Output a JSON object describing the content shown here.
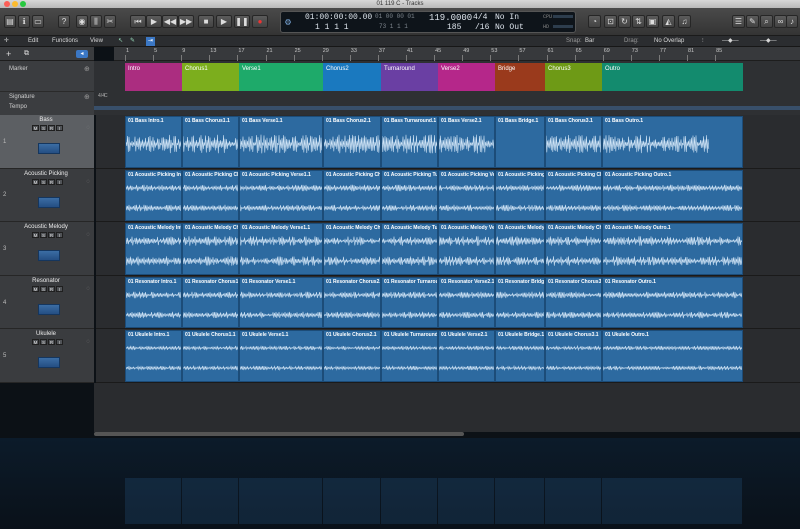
{
  "window": {
    "title": "01 119 C - Tracks"
  },
  "lcd": {
    "position_time": "01:00:00:00.00",
    "position_bars": "1 1 1 1",
    "right_time": "01 00 00 01",
    "right_bars": "73 1 1 1",
    "tempo": "119.0000",
    "tempo_sub": "185",
    "signature": "4/4",
    "division": "/16",
    "in": "No In",
    "out": "No Out",
    "cpu": "CPU",
    "hd": "HD"
  },
  "menu": {
    "edit": "Edit",
    "functions": "Functions",
    "view": "View",
    "snap_label": "Snap:",
    "snap_value": "Bar",
    "drag_label": "Drag:",
    "drag_value": "No Overlap"
  },
  "ruler": {
    "ticks": [
      "1",
      "5",
      "9",
      "13",
      "17",
      "21",
      "25",
      "29",
      "33",
      "37",
      "41",
      "45",
      "49",
      "53",
      "57",
      "61",
      "65",
      "69",
      "73",
      "77",
      "81",
      "85"
    ]
  },
  "global_tracks": {
    "marker": "Marker",
    "signature": "Signature",
    "tempo": "Tempo",
    "sig_value": "4/4",
    "key": "C"
  },
  "markers": [
    {
      "label": "Intro",
      "color": "#ab2d80"
    },
    {
      "label": "Chorus1",
      "color": "#7cae1d"
    },
    {
      "label": "Verse1",
      "color": "#1eaa6a"
    },
    {
      "label": "Chorus2",
      "color": "#1a79bf"
    },
    {
      "label": "Turnaround",
      "color": "#6a3fa3"
    },
    {
      "label": "Verse2",
      "color": "#b5278a"
    },
    {
      "label": "Bridge",
      "color": "#9a3a1c"
    },
    {
      "label": "Chorus3",
      "color": "#6e9a16"
    },
    {
      "label": "Outro",
      "color": "#138b6e"
    }
  ],
  "tracks": [
    {
      "num": "1",
      "name": "Bass",
      "m": "M",
      "s": "S",
      "r": "R",
      "i": "I",
      "regions": [
        "01 Bass Intro.1",
        "01 Bass Chorus1.1",
        "01 Bass Verse1.1",
        "01 Bass Chorus2.1",
        "01 Bass Turnaround.1",
        "01 Bass Verse2.1",
        "01 Bass Bridge.1",
        "01 Bass Chorus3.1",
        "01 Bass Outro.1"
      ]
    },
    {
      "num": "2",
      "name": "Acoustic Picking",
      "m": "M",
      "s": "S",
      "r": "R",
      "i": "I",
      "regions": [
        "01 Acoustic Picking Intro",
        "01 Acoustic Picking Cho",
        "01 Acoustic Picking Verse1.1",
        "01 Acoustic Picking Cho",
        "01 Acoustic Picking Turn",
        "01 Acoustic Picking Ver",
        "01 Acoustic Picking B",
        "01 Acoustic Picking Cho",
        "01 Acoustic Picking Outro.1"
      ]
    },
    {
      "num": "3",
      "name": "Acoustic Melody",
      "m": "M",
      "s": "S",
      "r": "R",
      "i": "I",
      "regions": [
        "01 Acoustic Melody Intro",
        "01 Acoustic Melody Cho",
        "01 Acoustic Melody Verse1.1",
        "01 Acoustic Melody Cho",
        "01 Acoustic Melody Turn",
        "01 Acoustic Melody Ver",
        "01 Acoustic Melody B",
        "01 Acoustic Melody Cho",
        "01 Acoustic Melody Outro.1"
      ]
    },
    {
      "num": "4",
      "name": "Resonator",
      "m": "M",
      "s": "S",
      "r": "R",
      "i": "I",
      "regions": [
        "01 Resonator Intro.1",
        "01 Resonator Chorus1.1",
        "01 Resonator Verse1.1",
        "01 Resonator Chorus2.1",
        "01 Resonator Turnaroun",
        "01 Resonator Verse2.1",
        "01 Resonator Bridge.",
        "01 Resonator Chorus3.1",
        "01 Resonator Outro.1"
      ]
    },
    {
      "num": "5",
      "name": "Ukulele",
      "m": "M",
      "s": "S",
      "r": "R",
      "i": "I",
      "regions": [
        "01 Ukulele Intro.1",
        "01 Ukulele Chorus1.1",
        "01 Ukulele Verse1.1",
        "01 Ukulele Chorus2.1",
        "01 Ukulele Turnaround.1",
        "01 Ukulele Verse2.1",
        "01 Ukulele Bridge.1",
        "01 Ukulele Chorus3.1",
        "01 Ukulele Outro.1"
      ]
    }
  ]
}
